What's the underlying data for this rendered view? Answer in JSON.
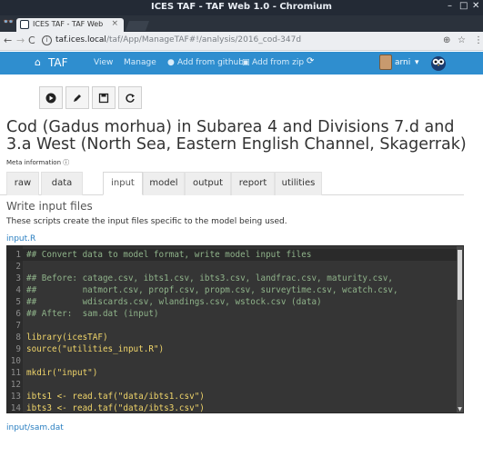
{
  "window": {
    "title": "ICES TAF - TAF Web 1.0 - Chromium",
    "minimize": "–",
    "maximize": "□",
    "close": "✕"
  },
  "browser": {
    "tab_title": "ICES TAF - TAF Web",
    "tab_close": "×",
    "url_domain": "taf.ices.local",
    "url_path": "/taf/App/ManageTAF#!/analysis/2016_cod-347d"
  },
  "navbar": {
    "brand": "TAF",
    "items": [
      "View",
      "Manage",
      "Add from github",
      "Add from zip"
    ],
    "user": "arni"
  },
  "page": {
    "title": "Cod (Gadus morhua) in Subarea 4 and Divisions 7.d and 3.a West (North Sea, Eastern English Channel, Skagerrak)",
    "meta_label": "Meta information"
  },
  "tabs": [
    "raw",
    "data",
    "input",
    "model",
    "output",
    "report",
    "utilities"
  ],
  "active_tab": "input",
  "section": {
    "title": "Write input files",
    "description": "These scripts create the input files specific to the model being used."
  },
  "files": {
    "script": "input.R",
    "output": "input/sam.dat"
  },
  "code_lines": [
    {
      "n": "1",
      "text": "## Convert data to model format, write model input files",
      "kind": "comment"
    },
    {
      "n": "2",
      "text": "",
      "kind": "comment"
    },
    {
      "n": "3",
      "text": "## Before: catage.csv, ibts1.csv, ibts3.csv, landfrac.csv, maturity.csv,",
      "kind": "comment"
    },
    {
      "n": "4",
      "text": "##         natmort.csv, propf.csv, propm.csv, surveytime.csv, wcatch.csv,",
      "kind": "comment"
    },
    {
      "n": "5",
      "text": "##         wdiscards.csv, wlandings.csv, wstock.csv (data)",
      "kind": "comment"
    },
    {
      "n": "6",
      "text": "## After:  sam.dat (input)",
      "kind": "comment"
    },
    {
      "n": "7",
      "text": "",
      "kind": "code"
    },
    {
      "n": "8",
      "text": "library(icesTAF)",
      "kind": "code"
    },
    {
      "n": "9",
      "text": "source(\"utilities_input.R\")",
      "kind": "code"
    },
    {
      "n": "10",
      "text": "",
      "kind": "code"
    },
    {
      "n": "11",
      "text": "mkdir(\"input\")",
      "kind": "code"
    },
    {
      "n": "12",
      "text": "",
      "kind": "code"
    },
    {
      "n": "13",
      "text": "ibts1 <- read.taf(\"data/ibts1.csv\")",
      "kind": "code"
    },
    {
      "n": "14",
      "text": "ibts3 <- read.taf(\"data/ibts3.csv\")",
      "kind": "code"
    }
  ]
}
